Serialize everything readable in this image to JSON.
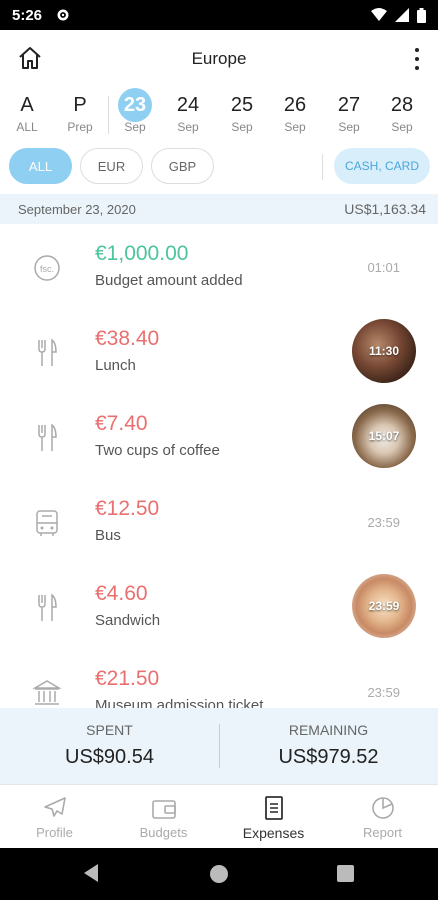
{
  "status": {
    "time": "5:26"
  },
  "header": {
    "title": "Europe"
  },
  "dates": [
    {
      "big": "A",
      "small": "ALL"
    },
    {
      "big": "P",
      "small": "Prep"
    },
    {
      "big": "23",
      "small": "Sep"
    },
    {
      "big": "24",
      "small": "Sep"
    },
    {
      "big": "25",
      "small": "Sep"
    },
    {
      "big": "26",
      "small": "Sep"
    },
    {
      "big": "27",
      "small": "Sep"
    },
    {
      "big": "28",
      "small": "Sep"
    }
  ],
  "selected_date_index": 2,
  "filters": {
    "all": "ALL",
    "eur": "EUR",
    "gbp": "GBP",
    "payment": "CASH, CARD"
  },
  "day": {
    "date": "September 23, 2020",
    "total": "US$1,163.34"
  },
  "expenses": [
    {
      "amount": "€1,000.00",
      "desc": "Budget amount added",
      "time": "01:01",
      "icon": "budget-coin-icon",
      "type": "income"
    },
    {
      "amount": "€38.40",
      "desc": "Lunch",
      "time": "11:30",
      "icon": "fork-knife-icon",
      "type": "expense",
      "photo": "lunch"
    },
    {
      "amount": "€7.40",
      "desc": "Two cups of coffee",
      "time": "15:07",
      "icon": "fork-knife-icon",
      "type": "expense",
      "photo": "coffee"
    },
    {
      "amount": "€12.50",
      "desc": "Bus",
      "time": "23:59",
      "icon": "bus-icon",
      "type": "expense"
    },
    {
      "amount": "€4.60",
      "desc": "Sandwich",
      "time": "23:59",
      "icon": "fork-knife-icon",
      "type": "expense",
      "photo": "sandwich"
    },
    {
      "amount": "€21.50",
      "desc": "Museum admission ticket",
      "time": "23:59",
      "icon": "museum-icon",
      "type": "expense"
    }
  ],
  "summary": {
    "spent_label": "SPENT",
    "spent_value": "US$90.54",
    "remaining_label": "REMAINING",
    "remaining_value": "US$979.52"
  },
  "tabs": [
    {
      "label": "Profile",
      "icon": "airplane-icon"
    },
    {
      "label": "Budgets",
      "icon": "wallet-icon"
    },
    {
      "label": "Expenses",
      "icon": "receipt-icon"
    },
    {
      "label": "Report",
      "icon": "pie-chart-icon"
    }
  ],
  "active_tab_index": 2,
  "colors": {
    "accent": "#8fcff2",
    "expense": "#ea6f6f",
    "income": "#4cc59a",
    "panel": "#eaf4fa"
  }
}
